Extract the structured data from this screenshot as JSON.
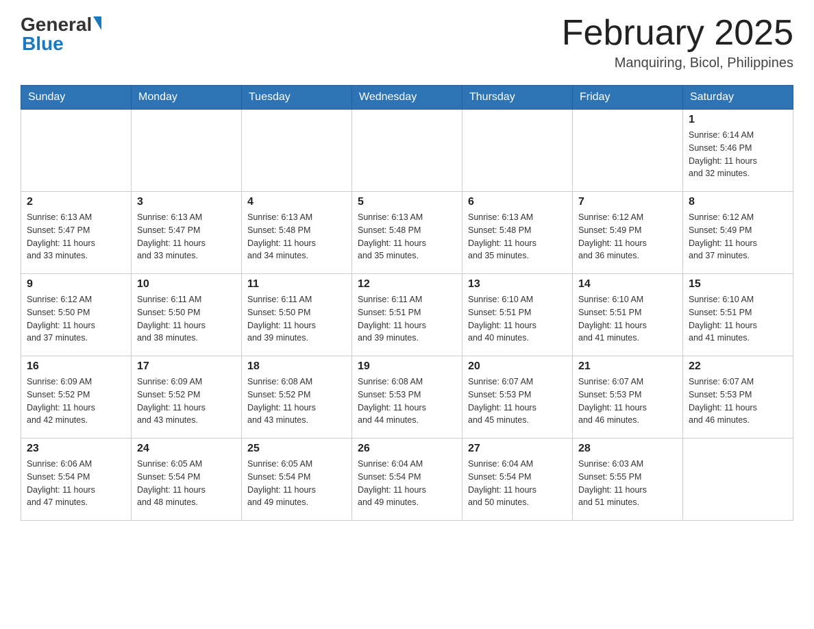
{
  "header": {
    "logo_general": "General",
    "logo_blue": "Blue",
    "month_title": "February 2025",
    "location": "Manquiring, Bicol, Philippines"
  },
  "weekdays": [
    "Sunday",
    "Monday",
    "Tuesday",
    "Wednesday",
    "Thursday",
    "Friday",
    "Saturday"
  ],
  "weeks": [
    [
      {
        "day": "",
        "info": ""
      },
      {
        "day": "",
        "info": ""
      },
      {
        "day": "",
        "info": ""
      },
      {
        "day": "",
        "info": ""
      },
      {
        "day": "",
        "info": ""
      },
      {
        "day": "",
        "info": ""
      },
      {
        "day": "1",
        "info": "Sunrise: 6:14 AM\nSunset: 5:46 PM\nDaylight: 11 hours\nand 32 minutes."
      }
    ],
    [
      {
        "day": "2",
        "info": "Sunrise: 6:13 AM\nSunset: 5:47 PM\nDaylight: 11 hours\nand 33 minutes."
      },
      {
        "day": "3",
        "info": "Sunrise: 6:13 AM\nSunset: 5:47 PM\nDaylight: 11 hours\nand 33 minutes."
      },
      {
        "day": "4",
        "info": "Sunrise: 6:13 AM\nSunset: 5:48 PM\nDaylight: 11 hours\nand 34 minutes."
      },
      {
        "day": "5",
        "info": "Sunrise: 6:13 AM\nSunset: 5:48 PM\nDaylight: 11 hours\nand 35 minutes."
      },
      {
        "day": "6",
        "info": "Sunrise: 6:13 AM\nSunset: 5:48 PM\nDaylight: 11 hours\nand 35 minutes."
      },
      {
        "day": "7",
        "info": "Sunrise: 6:12 AM\nSunset: 5:49 PM\nDaylight: 11 hours\nand 36 minutes."
      },
      {
        "day": "8",
        "info": "Sunrise: 6:12 AM\nSunset: 5:49 PM\nDaylight: 11 hours\nand 37 minutes."
      }
    ],
    [
      {
        "day": "9",
        "info": "Sunrise: 6:12 AM\nSunset: 5:50 PM\nDaylight: 11 hours\nand 37 minutes."
      },
      {
        "day": "10",
        "info": "Sunrise: 6:11 AM\nSunset: 5:50 PM\nDaylight: 11 hours\nand 38 minutes."
      },
      {
        "day": "11",
        "info": "Sunrise: 6:11 AM\nSunset: 5:50 PM\nDaylight: 11 hours\nand 39 minutes."
      },
      {
        "day": "12",
        "info": "Sunrise: 6:11 AM\nSunset: 5:51 PM\nDaylight: 11 hours\nand 39 minutes."
      },
      {
        "day": "13",
        "info": "Sunrise: 6:10 AM\nSunset: 5:51 PM\nDaylight: 11 hours\nand 40 minutes."
      },
      {
        "day": "14",
        "info": "Sunrise: 6:10 AM\nSunset: 5:51 PM\nDaylight: 11 hours\nand 41 minutes."
      },
      {
        "day": "15",
        "info": "Sunrise: 6:10 AM\nSunset: 5:51 PM\nDaylight: 11 hours\nand 41 minutes."
      }
    ],
    [
      {
        "day": "16",
        "info": "Sunrise: 6:09 AM\nSunset: 5:52 PM\nDaylight: 11 hours\nand 42 minutes."
      },
      {
        "day": "17",
        "info": "Sunrise: 6:09 AM\nSunset: 5:52 PM\nDaylight: 11 hours\nand 43 minutes."
      },
      {
        "day": "18",
        "info": "Sunrise: 6:08 AM\nSunset: 5:52 PM\nDaylight: 11 hours\nand 43 minutes."
      },
      {
        "day": "19",
        "info": "Sunrise: 6:08 AM\nSunset: 5:53 PM\nDaylight: 11 hours\nand 44 minutes."
      },
      {
        "day": "20",
        "info": "Sunrise: 6:07 AM\nSunset: 5:53 PM\nDaylight: 11 hours\nand 45 minutes."
      },
      {
        "day": "21",
        "info": "Sunrise: 6:07 AM\nSunset: 5:53 PM\nDaylight: 11 hours\nand 46 minutes."
      },
      {
        "day": "22",
        "info": "Sunrise: 6:07 AM\nSunset: 5:53 PM\nDaylight: 11 hours\nand 46 minutes."
      }
    ],
    [
      {
        "day": "23",
        "info": "Sunrise: 6:06 AM\nSunset: 5:54 PM\nDaylight: 11 hours\nand 47 minutes."
      },
      {
        "day": "24",
        "info": "Sunrise: 6:05 AM\nSunset: 5:54 PM\nDaylight: 11 hours\nand 48 minutes."
      },
      {
        "day": "25",
        "info": "Sunrise: 6:05 AM\nSunset: 5:54 PM\nDaylight: 11 hours\nand 49 minutes."
      },
      {
        "day": "26",
        "info": "Sunrise: 6:04 AM\nSunset: 5:54 PM\nDaylight: 11 hours\nand 49 minutes."
      },
      {
        "day": "27",
        "info": "Sunrise: 6:04 AM\nSunset: 5:54 PM\nDaylight: 11 hours\nand 50 minutes."
      },
      {
        "day": "28",
        "info": "Sunrise: 6:03 AM\nSunset: 5:55 PM\nDaylight: 11 hours\nand 51 minutes."
      },
      {
        "day": "",
        "info": ""
      }
    ]
  ]
}
